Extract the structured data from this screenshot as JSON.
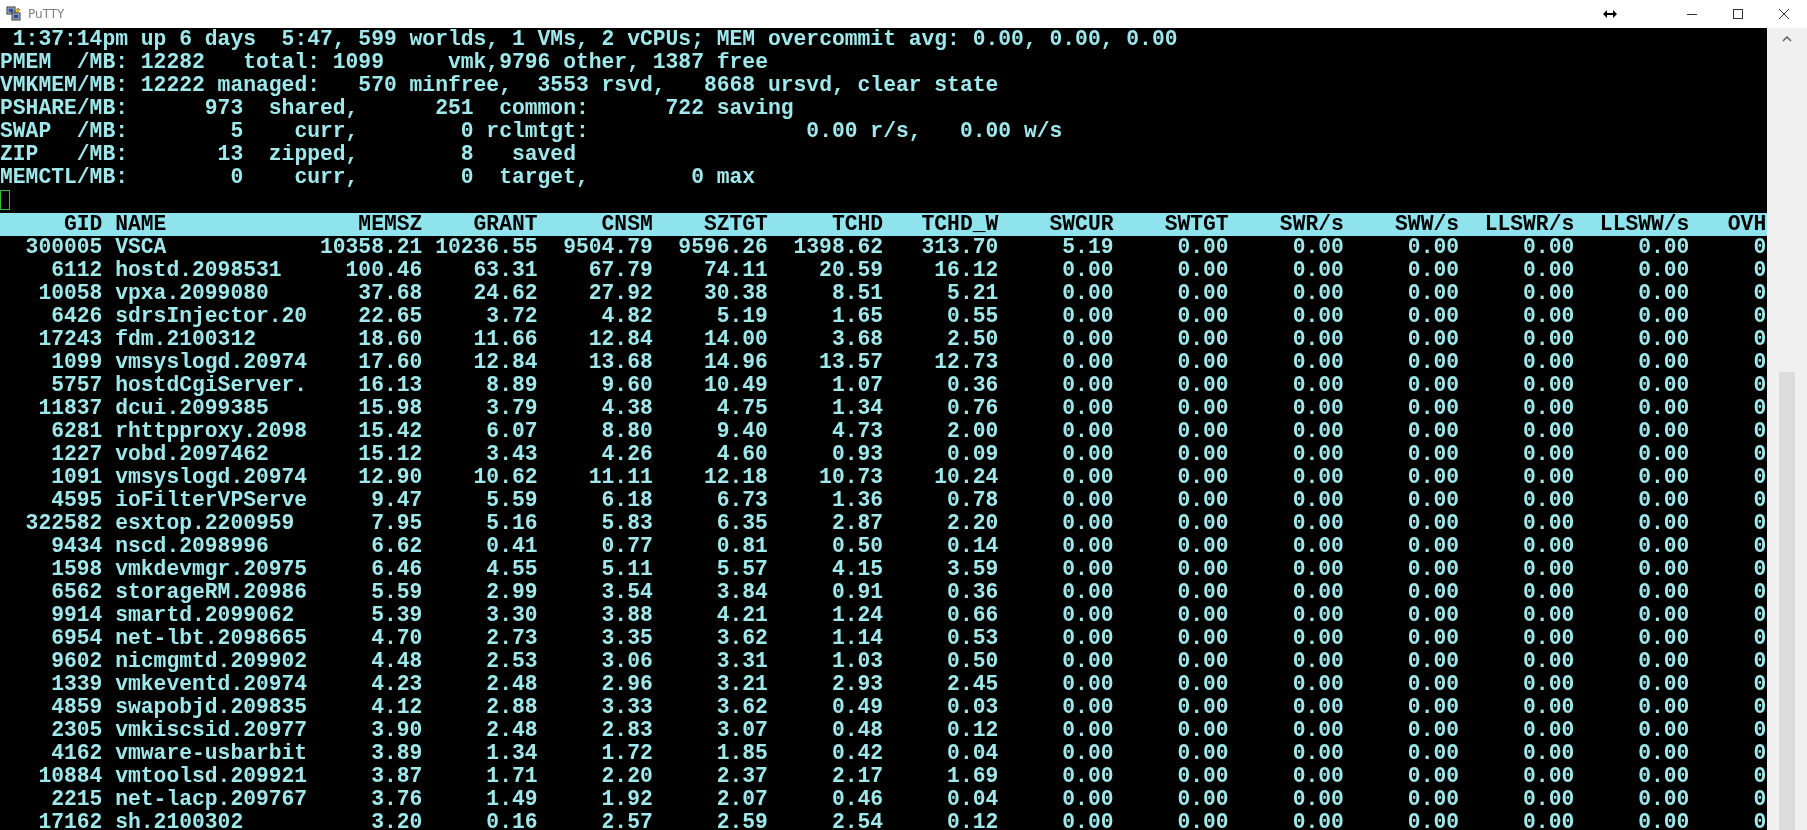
{
  "window": {
    "title": "PuTTY"
  },
  "summary_lines": [
    " 1:37:14pm up 6 days  5:47, 599 worlds, 1 VMs, 2 vCPUs; MEM overcommit avg: 0.00, 0.00, 0.00",
    "PMEM  /MB: 12282   total: 1099     vmk,9796 other, 1387 free",
    "VMKMEM/MB: 12222 managed:   570 minfree,  3553 rsvd,   8668 ursvd, clear state",
    "PSHARE/MB:      973  shared,      251  common:      722 saving",
    "SWAP  /MB:        5    curr,        0 rclmtgt:                 0.00 r/s,   0.00 w/s",
    "ZIP   /MB:       13  zipped,        8   saved",
    "MEMCTL/MB:        0    curr,        0  target,        0 max"
  ],
  "table": {
    "columns": [
      "GID",
      "NAME",
      "MEMSZ",
      "GRANT",
      "CNSM",
      "SZTGT",
      "TCHD",
      "TCHD_W",
      "SWCUR",
      "SWTGT",
      "SWR/s",
      "SWW/s",
      "LLSWR/s",
      "LLSWW/s",
      "OVH"
    ],
    "rows": [
      [
        "300005",
        "VSCA",
        "10358.21",
        "10236.55",
        "9504.79",
        "9596.26",
        "1398.62",
        "313.70",
        "5.19",
        "0.00",
        "0.00",
        "0.00",
        "0.00",
        "0.00",
        "0"
      ],
      [
        "6112",
        "hostd.2098531",
        "100.46",
        "63.31",
        "67.79",
        "74.11",
        "20.59",
        "16.12",
        "0.00",
        "0.00",
        "0.00",
        "0.00",
        "0.00",
        "0.00",
        "0"
      ],
      [
        "10058",
        "vpxa.2099080",
        "37.68",
        "24.62",
        "27.92",
        "30.38",
        "8.51",
        "5.21",
        "0.00",
        "0.00",
        "0.00",
        "0.00",
        "0.00",
        "0.00",
        "0"
      ],
      [
        "6426",
        "sdrsInjector.20",
        "22.65",
        "3.72",
        "4.82",
        "5.19",
        "1.65",
        "0.55",
        "0.00",
        "0.00",
        "0.00",
        "0.00",
        "0.00",
        "0.00",
        "0"
      ],
      [
        "17243",
        "fdm.2100312",
        "18.60",
        "11.66",
        "12.84",
        "14.00",
        "3.68",
        "2.50",
        "0.00",
        "0.00",
        "0.00",
        "0.00",
        "0.00",
        "0.00",
        "0"
      ],
      [
        "1099",
        "vmsyslogd.20974",
        "17.60",
        "12.84",
        "13.68",
        "14.96",
        "13.57",
        "12.73",
        "0.00",
        "0.00",
        "0.00",
        "0.00",
        "0.00",
        "0.00",
        "0"
      ],
      [
        "5757",
        "hostdCgiServer.",
        "16.13",
        "8.89",
        "9.60",
        "10.49",
        "1.07",
        "0.36",
        "0.00",
        "0.00",
        "0.00",
        "0.00",
        "0.00",
        "0.00",
        "0"
      ],
      [
        "11837",
        "dcui.2099385",
        "15.98",
        "3.79",
        "4.38",
        "4.75",
        "1.34",
        "0.76",
        "0.00",
        "0.00",
        "0.00",
        "0.00",
        "0.00",
        "0.00",
        "0"
      ],
      [
        "6281",
        "rhttpproxy.2098",
        "15.42",
        "6.07",
        "8.80",
        "9.40",
        "4.73",
        "2.00",
        "0.00",
        "0.00",
        "0.00",
        "0.00",
        "0.00",
        "0.00",
        "0"
      ],
      [
        "1227",
        "vobd.2097462",
        "15.12",
        "3.43",
        "4.26",
        "4.60",
        "0.93",
        "0.09",
        "0.00",
        "0.00",
        "0.00",
        "0.00",
        "0.00",
        "0.00",
        "0"
      ],
      [
        "1091",
        "vmsyslogd.20974",
        "12.90",
        "10.62",
        "11.11",
        "12.18",
        "10.73",
        "10.24",
        "0.00",
        "0.00",
        "0.00",
        "0.00",
        "0.00",
        "0.00",
        "0"
      ],
      [
        "4595",
        "ioFilterVPServe",
        "9.47",
        "5.59",
        "6.18",
        "6.73",
        "1.36",
        "0.78",
        "0.00",
        "0.00",
        "0.00",
        "0.00",
        "0.00",
        "0.00",
        "0"
      ],
      [
        "322582",
        "esxtop.2200959",
        "7.95",
        "5.16",
        "5.83",
        "6.35",
        "2.87",
        "2.20",
        "0.00",
        "0.00",
        "0.00",
        "0.00",
        "0.00",
        "0.00",
        "0"
      ],
      [
        "9434",
        "nscd.2098996",
        "6.62",
        "0.41",
        "0.77",
        "0.81",
        "0.50",
        "0.14",
        "0.00",
        "0.00",
        "0.00",
        "0.00",
        "0.00",
        "0.00",
        "0"
      ],
      [
        "1598",
        "vmkdevmgr.20975",
        "6.46",
        "4.55",
        "5.11",
        "5.57",
        "4.15",
        "3.59",
        "0.00",
        "0.00",
        "0.00",
        "0.00",
        "0.00",
        "0.00",
        "0"
      ],
      [
        "6562",
        "storageRM.20986",
        "5.59",
        "2.99",
        "3.54",
        "3.84",
        "0.91",
        "0.36",
        "0.00",
        "0.00",
        "0.00",
        "0.00",
        "0.00",
        "0.00",
        "0"
      ],
      [
        "9914",
        "smartd.2099062",
        "5.39",
        "3.30",
        "3.88",
        "4.21",
        "1.24",
        "0.66",
        "0.00",
        "0.00",
        "0.00",
        "0.00",
        "0.00",
        "0.00",
        "0"
      ],
      [
        "6954",
        "net-lbt.2098665",
        "4.70",
        "2.73",
        "3.35",
        "3.62",
        "1.14",
        "0.53",
        "0.00",
        "0.00",
        "0.00",
        "0.00",
        "0.00",
        "0.00",
        "0"
      ],
      [
        "9602",
        "nicmgmtd.209902",
        "4.48",
        "2.53",
        "3.06",
        "3.31",
        "1.03",
        "0.50",
        "0.00",
        "0.00",
        "0.00",
        "0.00",
        "0.00",
        "0.00",
        "0"
      ],
      [
        "1339",
        "vmkeventd.20974",
        "4.23",
        "2.48",
        "2.96",
        "3.21",
        "2.93",
        "2.45",
        "0.00",
        "0.00",
        "0.00",
        "0.00",
        "0.00",
        "0.00",
        "0"
      ],
      [
        "4859",
        "swapobjd.209835",
        "4.12",
        "2.88",
        "3.33",
        "3.62",
        "0.49",
        "0.03",
        "0.00",
        "0.00",
        "0.00",
        "0.00",
        "0.00",
        "0.00",
        "0"
      ],
      [
        "2305",
        "vmkiscsid.20977",
        "3.90",
        "2.48",
        "2.83",
        "3.07",
        "0.48",
        "0.12",
        "0.00",
        "0.00",
        "0.00",
        "0.00",
        "0.00",
        "0.00",
        "0"
      ],
      [
        "4162",
        "vmware-usbarbit",
        "3.89",
        "1.34",
        "1.72",
        "1.85",
        "0.42",
        "0.04",
        "0.00",
        "0.00",
        "0.00",
        "0.00",
        "0.00",
        "0.00",
        "0"
      ],
      [
        "10884",
        "vmtoolsd.209921",
        "3.87",
        "1.71",
        "2.20",
        "2.37",
        "2.17",
        "1.69",
        "0.00",
        "0.00",
        "0.00",
        "0.00",
        "0.00",
        "0.00",
        "0"
      ],
      [
        "2215",
        "net-lacp.209767",
        "3.76",
        "1.49",
        "1.92",
        "2.07",
        "0.46",
        "0.04",
        "0.00",
        "0.00",
        "0.00",
        "0.00",
        "0.00",
        "0.00",
        "0"
      ],
      [
        "17162",
        "sh.2100302",
        "3.20",
        "0.16",
        "2.57",
        "2.59",
        "2.54",
        "0.12",
        "0.00",
        "0.00",
        "0.00",
        "0.00",
        "0.00",
        "0.00",
        "0"
      ]
    ]
  }
}
